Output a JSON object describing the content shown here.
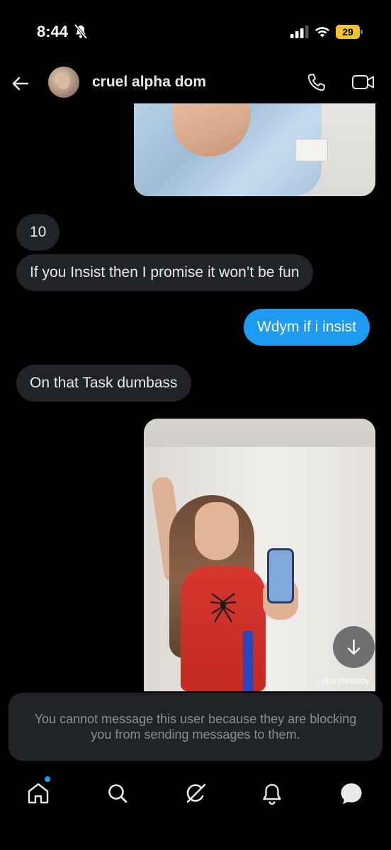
{
  "status_bar": {
    "time": "8:44",
    "battery": "29"
  },
  "header": {
    "contact_name": "cruel alpha dom"
  },
  "messages": [
    {
      "direction": "in",
      "text": "10"
    },
    {
      "direction": "in",
      "text": "If you Insist then I promise it won’t be fun"
    },
    {
      "direction": "out",
      "text": "Wdym if i insist"
    },
    {
      "direction": "in",
      "text": "On that Task dumbass"
    }
  ],
  "media": {
    "watermark": "@skybribaby"
  },
  "composer": {
    "blocked_notice": "You cannot message this user because they are blocking you from sending messages to them."
  },
  "colors": {
    "accent": "#1d9bf0",
    "incoming_bubble": "#202327",
    "battery": "#f2c232"
  }
}
